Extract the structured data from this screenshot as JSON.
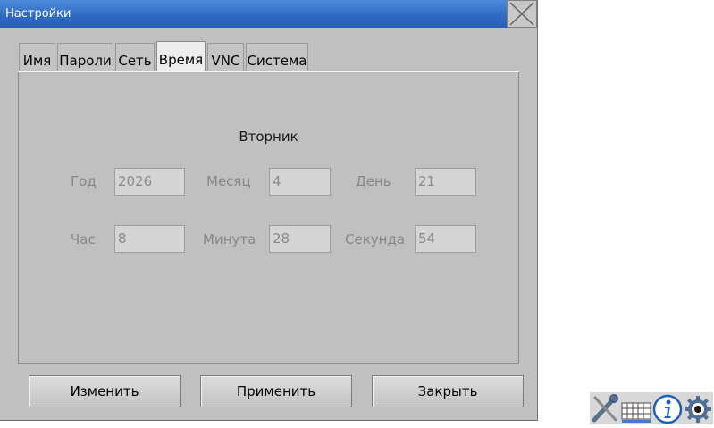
{
  "window": {
    "title": "Настройки"
  },
  "tabs": [
    {
      "label": "Имя",
      "active": false
    },
    {
      "label": "Пароли",
      "active": false
    },
    {
      "label": "Сеть",
      "active": false
    },
    {
      "label": "Время",
      "active": true
    },
    {
      "label": "VNC",
      "active": false
    },
    {
      "label": "Система",
      "active": false
    }
  ],
  "time": {
    "weekday": "Вторник",
    "year_label": "Год",
    "year": "2026",
    "month_label": "Месяц",
    "month": "4",
    "day_label": "День",
    "day": "21",
    "hour_label": "Час",
    "hour": "8",
    "minute_label": "Минута",
    "minute": "28",
    "second_label": "Секунда",
    "second": "54"
  },
  "buttons": {
    "change": "Изменить",
    "apply": "Применить",
    "close": "Закрыть"
  },
  "tray_icons": [
    "tools-icon",
    "keyboard-icon",
    "info-icon",
    "settings-gear-icon"
  ],
  "colors": {
    "titlebar": "#2f6bc4",
    "dialog_bg": "#c0c0c0"
  }
}
